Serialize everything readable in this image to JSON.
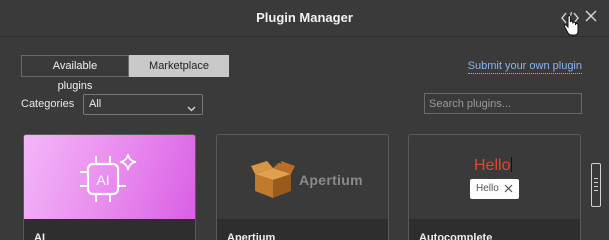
{
  "window": {
    "title": "Plugin Manager"
  },
  "tabs": [
    {
      "label": "Available plugins",
      "active": false
    },
    {
      "label": "Marketplace",
      "active": true
    }
  ],
  "submit_link": "Submit your own plugin",
  "categories": {
    "label": "Categories",
    "selected": "All"
  },
  "search": {
    "placeholder": "Search plugins...",
    "value": ""
  },
  "plugins": [
    {
      "name": "AI",
      "icon": "ai-chip-sparkle-icon"
    },
    {
      "name": "Apertium",
      "logo_text": "Apertium",
      "icon": "box-icon"
    },
    {
      "name": "Autocomplete",
      "preview_text": "Hello",
      "pill_text": "Hello"
    }
  ],
  "colors": {
    "ai_banner": "#e889ee",
    "link": "#8ab4f0",
    "autocomplete_red": "#e2472f"
  }
}
